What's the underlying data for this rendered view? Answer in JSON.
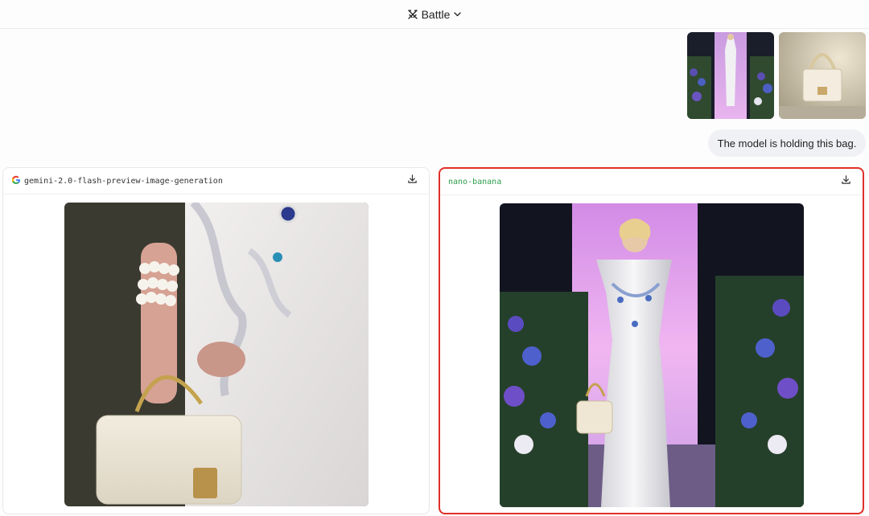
{
  "header": {
    "mode_label": "Battle",
    "mode_icon": "swords-icon"
  },
  "conversation": {
    "user_attachments": [
      {
        "alt": "runway model in white gown"
      },
      {
        "alt": "cream quilted handbag with pearl chain"
      }
    ],
    "user_message": "The model is holding this bag."
  },
  "responses": [
    {
      "model": "gemini-2.0-flash-preview-image-generation",
      "provider_icon": "google-logo-icon",
      "download_icon": "download-icon",
      "image_alt": "close-up of hand holding cream pearl handbag against embroidered white dress"
    },
    {
      "model": "nano-banana",
      "download_icon": "download-icon",
      "image_alt": "model walking runway in white gown holding cream bag",
      "highlighted": true,
      "model_color": "#2e9e4c",
      "highlight_color": "#e0302a"
    }
  ]
}
